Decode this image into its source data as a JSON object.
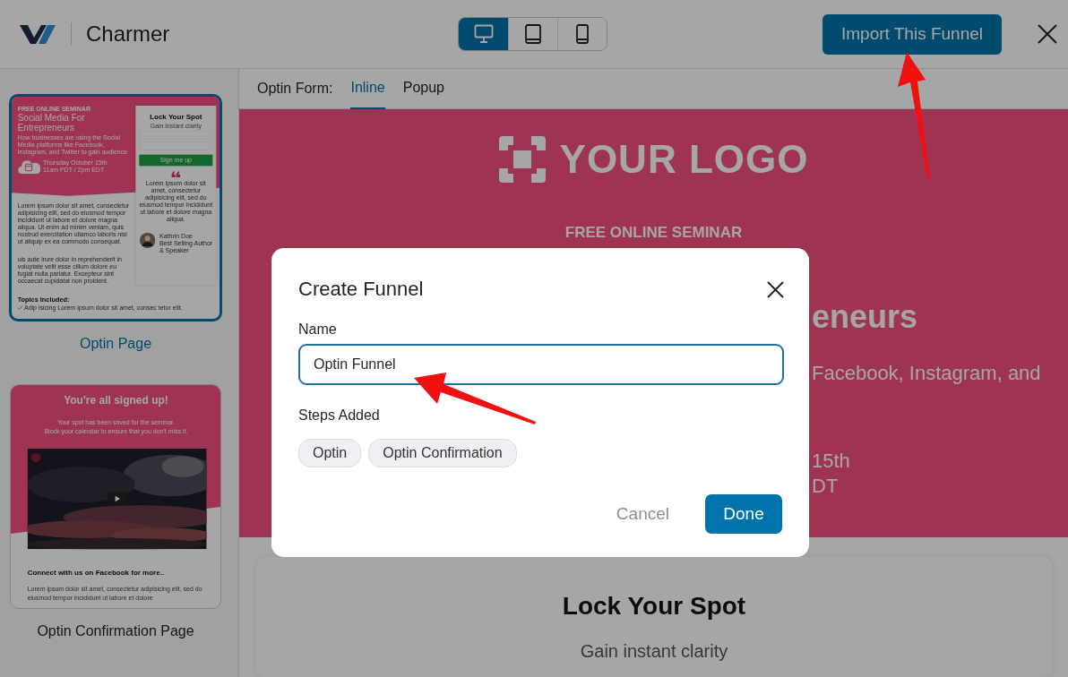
{
  "header": {
    "brand": "Charmer",
    "devices": [
      {
        "kind": "desktop",
        "selected": true
      },
      {
        "kind": "tablet",
        "selected": false
      },
      {
        "kind": "mobile",
        "selected": false
      }
    ],
    "import_button": "Import This Funnel"
  },
  "templates": [
    {
      "kind": "optin",
      "label": "Optin Page",
      "selected": true,
      "preview": {
        "eyebrow": "FREE ONLINE SEMINAR",
        "title": "Social Media For Entrepreneurs",
        "subtitle": "How businesses are using the Social Media platforms like Facebook, Instagram, and Twitter to gain audience",
        "date_lines": [
          "Thursday October 15th",
          "11am PDT / 2pm EDT"
        ],
        "form": {
          "title": "Lock Your Spot",
          "subtitle": "Gain instant clarity",
          "button": "Sign me up",
          "quote": "Lorem ipsum dolor sit amet, consectetur adipisicing elit, sed do eiusmod tempor incididunt ut labore et dolore magna aliqua.",
          "author": "Kathrin Doe",
          "author_role": "Best Selling Author & Speaker"
        },
        "paragraphs": [
          "Lorem ipsum dolor sit amet, consectetur adipisicing elit, sed do eiusmod tempor incididunt ut labore et dolore magna aliqua. Ut enim ad minim veniam, quis nostrud exercitation ullamco laboris nisi ut aliquip ex ea commodo consequat.",
          "uis aute irure dolor in reprehenderit in voluptate velit esse cillum dolore eu fugiat nulla pariatur. Excepteur sint occaecat cupidatat non proident."
        ],
        "topics_title": "Topics Included:",
        "topics": [
          "Adip isicing Lorem ipsum dolor sit amet, consec tetur elit."
        ]
      }
    },
    {
      "kind": "confirmation",
      "label": "Optin Confirmation Page",
      "selected": false,
      "preview": {
        "title": "You're all signed up!",
        "subtitle_lines": [
          "Your spot has been saved for the seminar.",
          "Block your calendar to ensure that you don't miss it."
        ],
        "video": {
          "kind": "picture"
        },
        "section_title": "Connect with us on Facebook for more..",
        "paragraph": "Lorem ipsum dolor sit amet, consectetur adipisicing elit, sed do eiusmod tempor incididunt ut labore et dolore"
      }
    }
  ],
  "preview_tabs": {
    "label": "Optin Form:",
    "tabs": [
      {
        "label": "Inline",
        "selected": true
      },
      {
        "label": "Popup",
        "selected": false
      }
    ]
  },
  "preview": {
    "logo": "YOUR LOGO",
    "eyebrow": "FREE ONLINE SEMINAR",
    "rows": [
      {
        "left": "",
        "right": "eneurs",
        "kind": "heading"
      },
      {
        "left": "",
        "right": "Facebook, Instagram, and",
        "kind": "subtitle"
      },
      {
        "left": "",
        "right": "15th",
        "kind": "date"
      },
      {
        "left": "",
        "right": "DT",
        "kind": "date"
      }
    ],
    "card": {
      "title": "Lock Your Spot",
      "subtitle": "Gain instant clarity"
    }
  },
  "modal": {
    "title": "Create Funnel",
    "name_label": "Name",
    "name_value": "Optin Funnel",
    "steps_label": "Steps Added",
    "steps": [
      "Optin",
      "Optin Confirmation"
    ],
    "cancel": "Cancel",
    "done": "Done"
  }
}
